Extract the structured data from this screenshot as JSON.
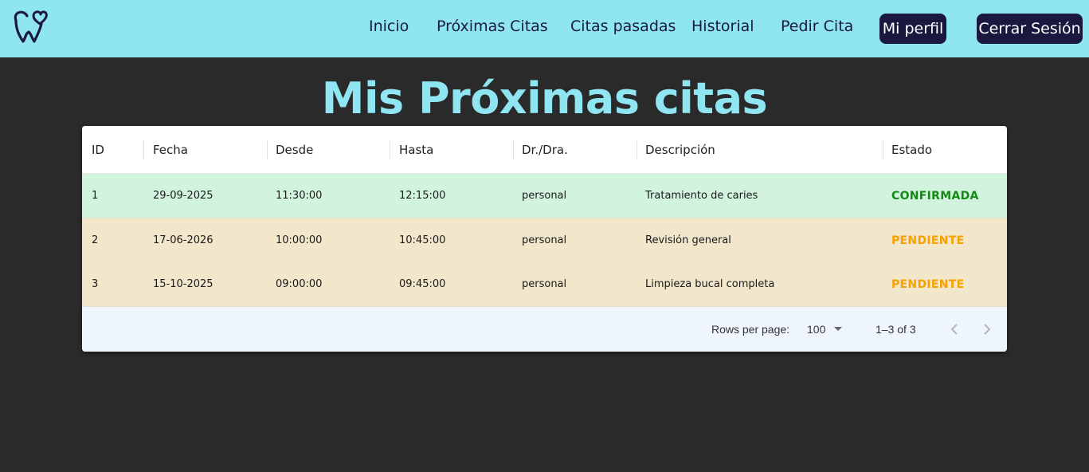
{
  "navbar": {
    "logo_icon": "tooth-heart-logo-icon",
    "links": [
      "Inicio",
      "Próximas Citas",
      "Citas pasadas",
      "Historial",
      "Pedir Cita"
    ],
    "profile_button": "Mi perfil",
    "logout_button": "Cerrar Sesión",
    "colors": {
      "background": "#8fe6f2",
      "button": "#19193f",
      "text": "#1a1a3e"
    }
  },
  "page": {
    "title": "Mis Próximas citas"
  },
  "table": {
    "columns": [
      "ID",
      "Fecha",
      "Desde",
      "Hasta",
      "Dr./Dra.",
      "Descripción",
      "Estado"
    ],
    "rows": [
      {
        "id": "1",
        "fecha": "29-09-2025",
        "desde": "11:30:00",
        "hasta": "12:15:00",
        "doctor": "personal",
        "descripcion": "Tratamiento de caries",
        "estado": "CONFIRMADA"
      },
      {
        "id": "2",
        "fecha": "17-06-2026",
        "desde": "10:00:00",
        "hasta": "10:45:00",
        "doctor": "personal",
        "descripcion": "Revisión general",
        "estado": "PENDIENTE"
      },
      {
        "id": "3",
        "fecha": "15-10-2025",
        "desde": "09:00:00",
        "hasta": "09:45:00",
        "doctor": "personal",
        "descripcion": "Limpieza bucal completa",
        "estado": "PENDIENTE"
      }
    ],
    "colors": {
      "confirmed_row": "#d2f3de",
      "pending_row": "#f2e6cb",
      "confirmed_text": "#108a10",
      "pending_text": "#f5a100"
    }
  },
  "pagination": {
    "rows_per_page_label": "Rows per page:",
    "rows_per_page_value": "100",
    "range_text": "1–3 of 3",
    "prev_icon": "chevron-left-icon",
    "next_icon": "chevron-right-icon"
  }
}
